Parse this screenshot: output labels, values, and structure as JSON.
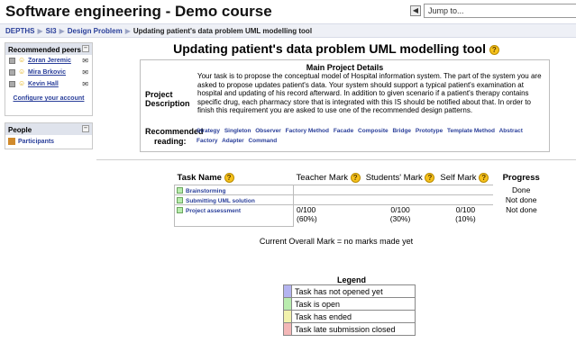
{
  "header": {
    "site_title": "Software engineering - Demo course",
    "jump_to": "Jump to..."
  },
  "breadcrumb": {
    "items": [
      "DEPTHS",
      "SI3",
      "Design Problem"
    ],
    "current": "Updating patient's data problem UML modelling tool"
  },
  "sidebar": {
    "peers_title": "Recommended peers",
    "peers": [
      {
        "name": "Zoran Jeremic"
      },
      {
        "name": "Mira Brkovic"
      },
      {
        "name": "Kevin Hall"
      }
    ],
    "configure": "Configure your account",
    "people_title": "People",
    "participants": "Participants"
  },
  "main": {
    "title": "Updating patient's data problem UML modelling tool",
    "details_title": "Main Project Details",
    "project_label": "Project",
    "description_label": "Description",
    "description": "Your task is to propose the conceptual model of Hospital information system. The part of the system you are asked to propose updates patient's data. Your system should support a typical patient's examination at hospital and updating of his record afterward. In addition to given scenario if a patient's therapy contains specific drug, each pharmacy store that is integrated with this IS should be notified about that. In order to finish this requirement you are asked to use one of the recommended design patterns.",
    "recommended_label": "Recommended",
    "reading_label": "reading:",
    "patterns": [
      "Strategy",
      "Singleton",
      "Observer",
      "Factory Method",
      "Facade",
      "Composite",
      "Bridge",
      "Prototype",
      "Template Method",
      "Abstract Factory",
      "Adapter",
      "Command"
    ]
  },
  "tasks": {
    "headers": {
      "task": "Task Name",
      "teacher": "Teacher Mark",
      "students": "Students' Mark",
      "self": "Self Mark",
      "progress": "Progress"
    },
    "rows": [
      {
        "name": "Brainstorming",
        "teacher": "",
        "teacher_pct": "",
        "students": "",
        "students_pct": "",
        "self": "",
        "self_pct": "",
        "progress": "Done"
      },
      {
        "name": "Submitting UML solution",
        "teacher": "",
        "teacher_pct": "",
        "students": "",
        "students_pct": "",
        "self": "",
        "self_pct": "",
        "progress": "Not done"
      },
      {
        "name": "Project assessment",
        "teacher": "0/100",
        "teacher_pct": "(60%)",
        "students": "0/100",
        "students_pct": "(30%)",
        "self": "0/100",
        "self_pct": "(10%)",
        "progress": "Not done"
      }
    ]
  },
  "overall": "Current Overall Mark = no marks made yet",
  "legend": {
    "title": "Legend",
    "items": [
      {
        "label": "Task has not opened yet",
        "color": "#b4b4f0"
      },
      {
        "label": "Task is open",
        "color": "#b9ecae"
      },
      {
        "label": "Task has ended",
        "color": "#f2f2ad"
      },
      {
        "label": "Task late submission closed",
        "color": "#f3b7b7"
      }
    ]
  }
}
